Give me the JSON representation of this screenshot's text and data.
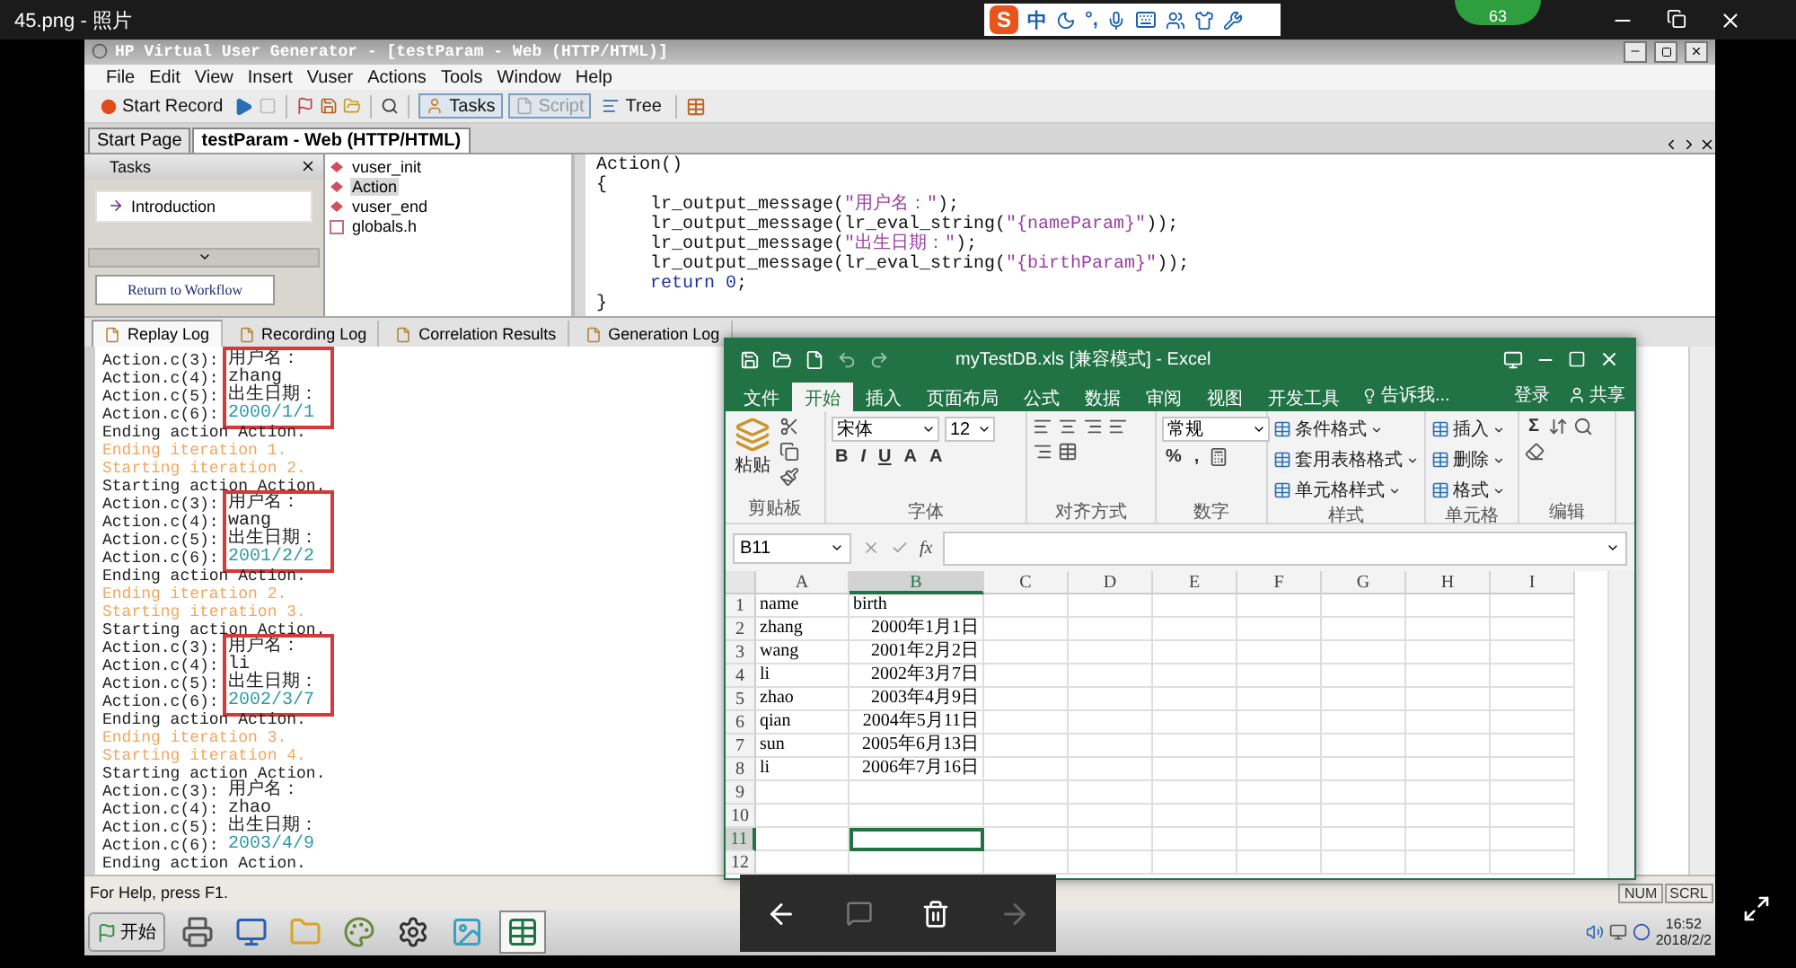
{
  "viewer": {
    "title": "45.png - 照片",
    "badge": "63",
    "next_enabled": false
  },
  "ime": {
    "logo": "S",
    "mode": "中",
    "punctuation": "°,"
  },
  "vugen": {
    "title": "HP Virtual User Generator - [testParam - Web (HTTP/HTML)]",
    "menu": [
      "File",
      "Edit",
      "View",
      "Insert",
      "Vuser",
      "Actions",
      "Tools",
      "Window",
      "Help"
    ],
    "toolbar": [
      {
        "label": "Start Record",
        "pressed": false,
        "disabled": false
      },
      {
        "label": "Tasks",
        "pressed": true,
        "disabled": false
      },
      {
        "label": "Script",
        "pressed": true,
        "disabled": true
      },
      {
        "label": "Tree",
        "pressed": false,
        "disabled": false
      }
    ],
    "doc_tabs": [
      {
        "label": "Start Page",
        "selected": false
      },
      {
        "label": "testParam - Web (HTTP/HTML)",
        "selected": true
      }
    ],
    "tasks_panel": {
      "title": "Tasks",
      "items": [
        "Introduction"
      ],
      "button": "Return to Workflow"
    },
    "tree": [
      {
        "label": "vuser_init",
        "kind": "action",
        "selected": false
      },
      {
        "label": "Action",
        "kind": "action",
        "selected": true
      },
      {
        "label": "vuser_end",
        "kind": "action",
        "selected": false
      },
      {
        "label": "globals.h",
        "kind": "header",
        "selected": false
      }
    ],
    "code": [
      {
        "indented": false,
        "tokens": [
          {
            "kind": "plain",
            "text": "Action()"
          }
        ]
      },
      {
        "indented": false,
        "tokens": [
          {
            "kind": "plain",
            "text": "{"
          }
        ]
      },
      {
        "indented": true,
        "tokens": [
          {
            "kind": "plain",
            "text": "lr_output_message("
          },
          {
            "kind": "string",
            "text": "\"用户名：\""
          },
          {
            "kind": "plain",
            "text": ");"
          }
        ]
      },
      {
        "indented": true,
        "tokens": [
          {
            "kind": "plain",
            "text": "lr_output_message(lr_eval_string("
          },
          {
            "kind": "string",
            "text": "\"{nameParam}\""
          },
          {
            "kind": "plain",
            "text": "));"
          }
        ]
      },
      {
        "indented": true,
        "tokens": [
          {
            "kind": "plain",
            "text": "lr_output_message("
          },
          {
            "kind": "string",
            "text": "\"出生日期：\""
          },
          {
            "kind": "plain",
            "text": ");"
          }
        ]
      },
      {
        "indented": true,
        "tokens": [
          {
            "kind": "plain",
            "text": "lr_output_message(lr_eval_string("
          },
          {
            "kind": "string",
            "text": "\"{birthParam}\""
          },
          {
            "kind": "plain",
            "text": "));"
          }
        ]
      },
      {
        "indented": true,
        "tokens": [
          {
            "kind": "keyword",
            "text": "return"
          },
          {
            "kind": "number",
            "text": " 0"
          },
          {
            "kind": "plain",
            "text": ";"
          }
        ]
      },
      {
        "indented": false,
        "tokens": [
          {
            "kind": "plain",
            "text": "}"
          }
        ]
      }
    ],
    "log_tabs": [
      {
        "label": "Replay Log",
        "selected": true
      },
      {
        "label": "Recording Log",
        "selected": false
      },
      {
        "label": "Correlation Results",
        "selected": false
      },
      {
        "label": "Generation Log",
        "selected": false
      }
    ],
    "log": [
      {
        "kind": "boxed",
        "lines": [
          {
            "source": "Action.c(3):",
            "message": "用户名：",
            "kind": "text"
          },
          {
            "source": "Action.c(4):",
            "message": "zhang",
            "kind": "text"
          },
          {
            "source": "Action.c(5):",
            "message": "出生日期：",
            "kind": "text"
          },
          {
            "source": "Action.c(6):",
            "message": "2000/1/1",
            "kind": "value"
          }
        ]
      },
      {
        "kind": "status",
        "text": "Ending action Action."
      },
      {
        "kind": "iteration",
        "text": "Ending iteration 1."
      },
      {
        "kind": "iteration",
        "text": "Starting iteration 2."
      },
      {
        "kind": "status",
        "text": "Starting action Action."
      },
      {
        "kind": "boxed",
        "lines": [
          {
            "source": "Action.c(3):",
            "message": "用户名：",
            "kind": "text"
          },
          {
            "source": "Action.c(4):",
            "message": "wang",
            "kind": "text"
          },
          {
            "source": "Action.c(5):",
            "message": "出生日期：",
            "kind": "text"
          },
          {
            "source": "Action.c(6):",
            "message": "2001/2/2",
            "kind": "value"
          }
        ]
      },
      {
        "kind": "status",
        "text": "Ending action Action."
      },
      {
        "kind": "iteration",
        "text": "Ending iteration 2."
      },
      {
        "kind": "iteration",
        "text": "Starting iteration 3."
      },
      {
        "kind": "status",
        "text": "Starting action Action."
      },
      {
        "kind": "boxed",
        "lines": [
          {
            "source": "Action.c(3):",
            "message": "用户名：",
            "kind": "text"
          },
          {
            "source": "Action.c(4):",
            "message": "li",
            "kind": "text"
          },
          {
            "source": "Action.c(5):",
            "message": "出生日期：",
            "kind": "text"
          },
          {
            "source": "Action.c(6):",
            "message": "2002/3/7",
            "kind": "value"
          }
        ]
      },
      {
        "kind": "status",
        "text": "Ending action Action."
      },
      {
        "kind": "iteration",
        "text": "Ending iteration 3."
      },
      {
        "kind": "iteration",
        "text": "Starting iteration 4."
      },
      {
        "kind": "status",
        "text": "Starting action Action."
      },
      {
        "kind": "output",
        "source": "Action.c(3):",
        "message": "用户名："
      },
      {
        "kind": "output",
        "source": "Action.c(4):",
        "message": "zhao"
      },
      {
        "kind": "output",
        "source": "Action.c(5):",
        "message": "出生日期："
      },
      {
        "kind": "output_value",
        "source": "Action.c(6):",
        "message": "2003/4/9"
      },
      {
        "kind": "status",
        "text": "Ending action Action."
      }
    ],
    "status": {
      "text": "For Help, press F1.",
      "indicators": [
        "NUM",
        "SCRL"
      ]
    }
  },
  "excel": {
    "title": "myTestDB.xls [兼容模式] - Excel",
    "tabs": [
      {
        "label": "文件",
        "selected": false
      },
      {
        "label": "开始",
        "selected": true
      },
      {
        "label": "插入",
        "selected": false
      },
      {
        "label": "页面布局",
        "selected": false
      },
      {
        "label": "公式",
        "selected": false
      },
      {
        "label": "数据",
        "selected": false
      },
      {
        "label": "审阅",
        "selected": false
      },
      {
        "label": "视图",
        "selected": false
      },
      {
        "label": "开发工具",
        "selected": false
      }
    ],
    "tell_me": "告诉我...",
    "sign_in": "登录",
    "share": "共享",
    "ribbon": [
      {
        "label": "剪贴板",
        "items": [
          {
            "kind": "big_button",
            "label": "粘贴"
          }
        ]
      },
      {
        "label": "字体",
        "items": [
          {
            "kind": "field",
            "value": "宋体"
          },
          {
            "kind": "field",
            "value": "12"
          },
          {
            "kind": "glyph",
            "text": "B"
          },
          {
            "kind": "glyph",
            "text": "I"
          },
          {
            "kind": "glyph",
            "text": "U"
          },
          {
            "kind": "glyph",
            "text": "A"
          },
          {
            "kind": "glyph",
            "text": "A"
          }
        ]
      },
      {
        "label": "对齐方式"
      },
      {
        "label": "数字",
        "items": [
          {
            "kind": "field",
            "value": "常规"
          },
          {
            "kind": "glyph",
            "text": "%"
          },
          {
            "kind": "glyph",
            "text": ","
          }
        ]
      },
      {
        "label": "样式",
        "items": [
          {
            "kind": "menu_button",
            "label": "条件格式"
          },
          {
            "kind": "menu_button",
            "label": "套用表格格式"
          },
          {
            "kind": "menu_button",
            "label": "单元格样式"
          }
        ]
      },
      {
        "label": "单元格",
        "items": [
          {
            "kind": "menu_button",
            "label": "插入"
          },
          {
            "kind": "menu_button",
            "label": "删除"
          },
          {
            "kind": "menu_button",
            "label": "格式"
          }
        ]
      },
      {
        "label": "编辑",
        "items": [
          {
            "kind": "glyph",
            "text": "Σ"
          }
        ]
      }
    ],
    "name_box": "B11",
    "function_label": "fx",
    "columns": [
      {
        "label": "A",
        "selected": false
      },
      {
        "label": "B",
        "selected": true
      },
      {
        "label": "C",
        "selected": false
      },
      {
        "label": "D",
        "selected": false
      },
      {
        "label": "E",
        "selected": false
      },
      {
        "label": "F",
        "selected": false
      },
      {
        "label": "G",
        "selected": false
      },
      {
        "label": "H",
        "selected": false
      },
      {
        "label": "I",
        "selected": false
      }
    ],
    "rows": [
      {
        "number": "1",
        "selected": false,
        "cells": [
          {
            "text": "name",
            "kind": "text",
            "selected": false
          },
          {
            "text": "birth",
            "kind": "text",
            "selected": false
          }
        ]
      },
      {
        "number": "2",
        "selected": false,
        "cells": [
          {
            "text": "zhang",
            "kind": "text",
            "selected": false
          },
          {
            "text": "2000年1月1日",
            "kind": "date",
            "selected": false
          }
        ]
      },
      {
        "number": "3",
        "selected": false,
        "cells": [
          {
            "text": "wang",
            "kind": "text",
            "selected": false
          },
          {
            "text": "2001年2月2日",
            "kind": "date",
            "selected": false
          }
        ]
      },
      {
        "number": "4",
        "selected": false,
        "cells": [
          {
            "text": "li",
            "kind": "text",
            "selected": false
          },
          {
            "text": "2002年3月7日",
            "kind": "date",
            "selected": false
          }
        ]
      },
      {
        "number": "5",
        "selected": false,
        "cells": [
          {
            "text": "zhao",
            "kind": "text",
            "selected": false
          },
          {
            "text": "2003年4月9日",
            "kind": "date",
            "selected": false
          }
        ]
      },
      {
        "number": "6",
        "selected": false,
        "cells": [
          {
            "text": "qian",
            "kind": "text",
            "selected": false
          },
          {
            "text": "2004年5月11日",
            "kind": "date",
            "selected": false
          }
        ]
      },
      {
        "number": "7",
        "selected": false,
        "cells": [
          {
            "text": "sun",
            "kind": "text",
            "selected": false
          },
          {
            "text": "2005年6月13日",
            "kind": "date",
            "selected": false
          }
        ]
      },
      {
        "number": "8",
        "selected": false,
        "cells": [
          {
            "text": "li",
            "kind": "text",
            "selected": false
          },
          {
            "text": "2006年7月16日",
            "kind": "date",
            "selected": false
          }
        ]
      },
      {
        "number": "9",
        "selected": false,
        "cells": [
          {
            "kind": "text",
            "selected": false
          },
          {
            "kind": "text",
            "selected": false
          }
        ]
      },
      {
        "number": "10",
        "selected": false,
        "cells": [
          {
            "kind": "text",
            "selected": false
          },
          {
            "kind": "text",
            "selected": false
          }
        ]
      },
      {
        "number": "11",
        "selected": true,
        "cells": [
          {
            "kind": "text",
            "selected": false
          },
          {
            "kind": "text",
            "selected": true
          }
        ]
      },
      {
        "number": "12",
        "selected": false,
        "cells": [
          {
            "kind": "text",
            "selected": false
          },
          {
            "kind": "text",
            "selected": false
          }
        ]
      }
    ]
  },
  "taskbar": {
    "start": "开始",
    "time": "16:52",
    "date": "2018/2/2"
  }
}
